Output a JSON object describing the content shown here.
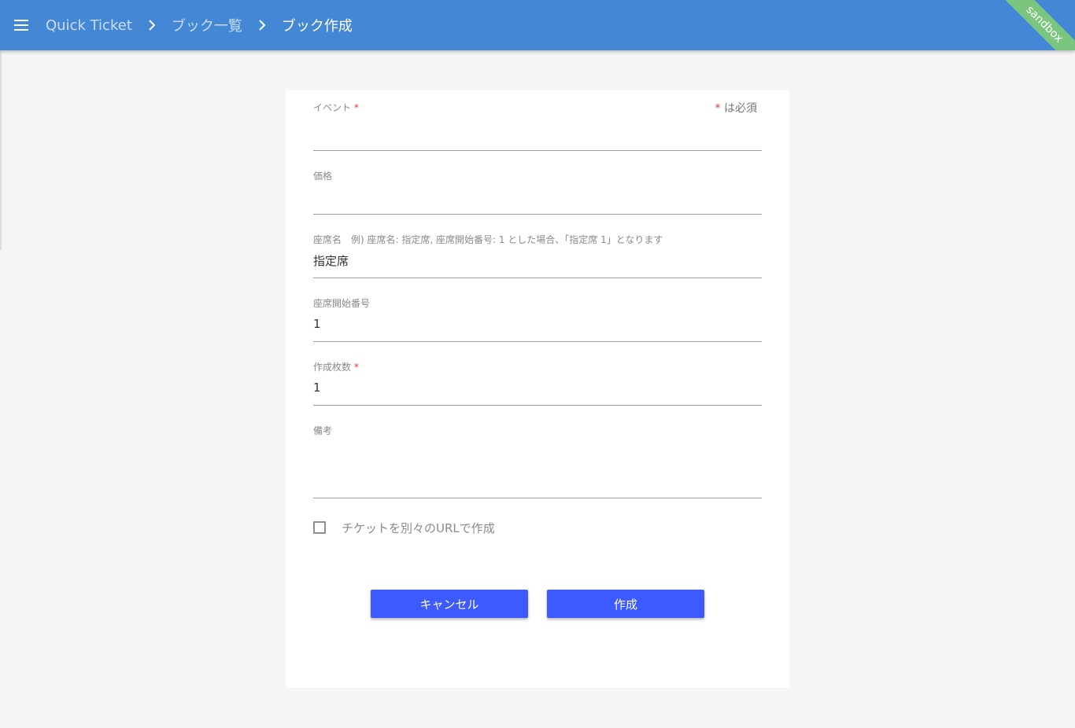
{
  "appbar": {
    "menu_icon": "hamburger-menu-icon",
    "breadcrumbs": [
      {
        "label": "Quick Ticket"
      },
      {
        "label": "ブック一覧"
      },
      {
        "label": "ブック作成"
      }
    ],
    "separator_icon": "chevron-right-icon",
    "ribbon": "sandbox",
    "colors": {
      "bar": "#4487d4",
      "ribbon": "#7bc67e"
    }
  },
  "form": {
    "required_note": {
      "star": "*",
      "text": " は必須"
    },
    "fields": {
      "event": {
        "label": "イベント",
        "star": " *",
        "value": ""
      },
      "price": {
        "label": "価格",
        "value": ""
      },
      "seat_name": {
        "label": "座席名　例) 座席名: 指定席, 座席開始番号: 1 とした場合、「指定席 1」となります",
        "value": "指定席"
      },
      "seat_start": {
        "label": "座席開始番号",
        "value": "1"
      },
      "count": {
        "label": "作成枚数",
        "star": " *",
        "value": "1"
      },
      "note": {
        "label": "備考",
        "value": ""
      }
    },
    "checkbox": {
      "label": "チケットを別々のURLで作成",
      "checked": false
    },
    "buttons": {
      "cancel": "キャンセル",
      "create": "作成"
    },
    "colors": {
      "button": "#3d5afe",
      "required": "#e53935"
    }
  }
}
